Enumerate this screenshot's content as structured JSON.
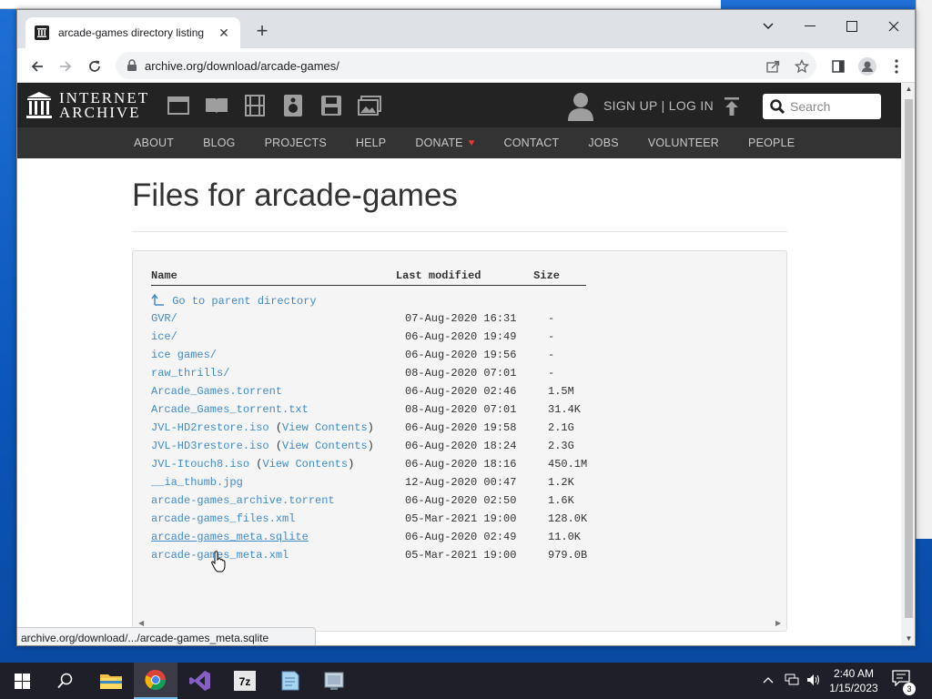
{
  "browser": {
    "tab_title": "arcade-games directory listing",
    "new_tab": "+",
    "url": "archive.org/download/arcade-games/",
    "status_url": "archive.org/download/.../arcade-games_meta.sqlite"
  },
  "ia_header": {
    "logo_line1": "INTERNET",
    "logo_line2": "ARCHIVE",
    "signup": "SIGN UP | LOG IN",
    "search_placeholder": "Search",
    "nav": [
      "ABOUT",
      "BLOG",
      "PROJECTS",
      "HELP",
      "DONATE",
      "CONTACT",
      "JOBS",
      "VOLUNTEER",
      "PEOPLE"
    ]
  },
  "page": {
    "title": "Files for arcade-games"
  },
  "listing": {
    "headers": {
      "name": "Name",
      "modified": "Last modified",
      "size": "Size"
    },
    "parent": "Go to parent directory",
    "view_contents": "View Contents",
    "rows": [
      {
        "name": "GVR/",
        "modified": "07-Aug-2020 16:31",
        "size": "-"
      },
      {
        "name": "ice/",
        "modified": "06-Aug-2020 19:49",
        "size": "-"
      },
      {
        "name": "ice games/",
        "modified": "06-Aug-2020 19:56",
        "size": "-"
      },
      {
        "name": "raw_thrills/",
        "modified": "08-Aug-2020 07:01",
        "size": "-"
      },
      {
        "name": "Arcade_Games.torrent",
        "modified": "06-Aug-2020 02:46",
        "size": "1.5M"
      },
      {
        "name": "Arcade_Games_torrent.txt",
        "modified": "08-Aug-2020 07:01",
        "size": "31.4K"
      },
      {
        "name": "JVL-HD2restore.iso",
        "view": true,
        "modified": "06-Aug-2020 19:58",
        "size": "2.1G"
      },
      {
        "name": "JVL-HD3restore.iso",
        "view": true,
        "modified": "06-Aug-2020 18:24",
        "size": "2.3G"
      },
      {
        "name": "JVL-Itouch8.iso",
        "view": true,
        "modified": "06-Aug-2020 18:16",
        "size": "450.1M"
      },
      {
        "name": "__ia_thumb.jpg",
        "modified": "12-Aug-2020 00:47",
        "size": "1.2K"
      },
      {
        "name": "arcade-games_archive.torrent",
        "modified": "06-Aug-2020 02:50",
        "size": "1.6K"
      },
      {
        "name": "arcade-games_files.xml",
        "modified": "05-Mar-2021 19:00",
        "size": "128.0K"
      },
      {
        "name": "arcade-games_meta.sqlite",
        "hovered": true,
        "modified": "06-Aug-2020 02:49",
        "size": "11.0K"
      },
      {
        "name": "arcade-games_meta.xml",
        "modified": "05-Mar-2021 19:00",
        "size": "979.0B"
      }
    ]
  },
  "taskbar": {
    "time": "2:40 AM",
    "date": "1/15/2023",
    "notification_count": "3",
    "apps": [
      "file-explorer",
      "chrome",
      "visual-studio",
      "7zip",
      "notepad-app",
      "settings-app"
    ]
  },
  "colors": {
    "link": "#428bca",
    "ia_header_bg": "#232323",
    "ia_nav_bg": "#333333"
  }
}
